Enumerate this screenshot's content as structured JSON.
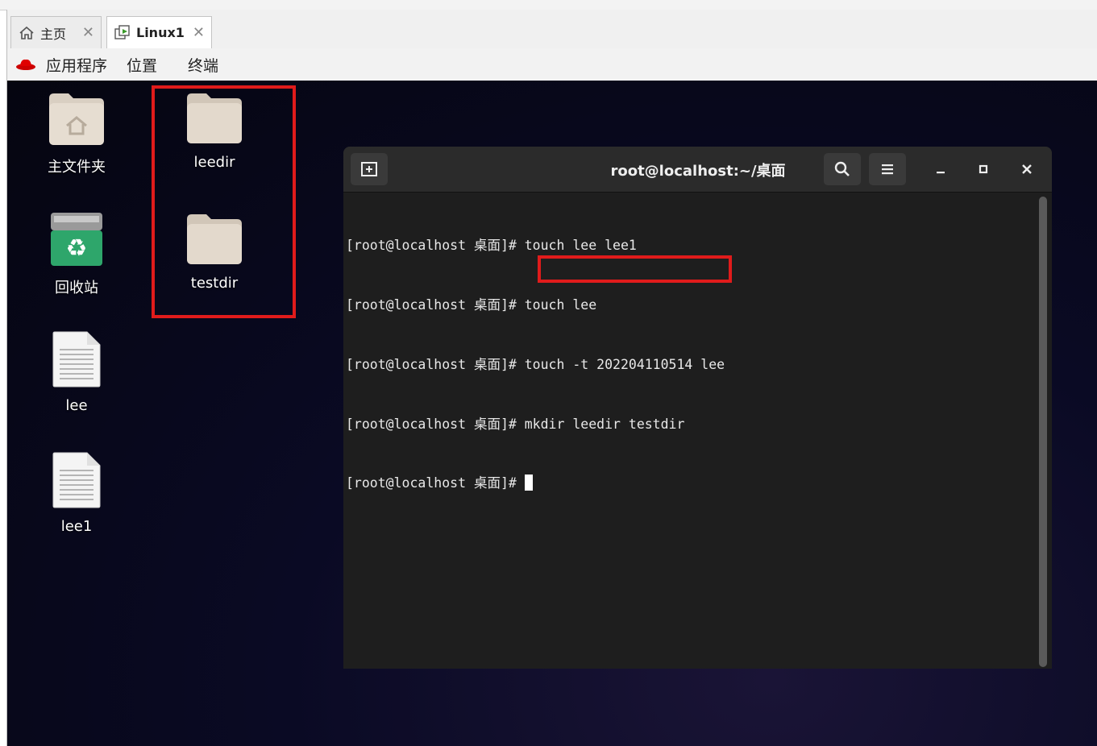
{
  "tabs": [
    {
      "label": "主页",
      "icon": "home-icon",
      "active": false
    },
    {
      "label": "Linux1",
      "icon": "vm-icon",
      "active": true
    }
  ],
  "menubar": {
    "items": [
      "应用程序",
      "位置",
      "终端"
    ]
  },
  "desktop": {
    "icons": [
      {
        "label": "主文件夹",
        "icon": "home-folder-icon"
      },
      {
        "label": "回收站",
        "icon": "trash-icon"
      },
      {
        "label": "lee",
        "icon": "text-file-icon"
      },
      {
        "label": "lee1",
        "icon": "text-file-icon"
      },
      {
        "label": "leedir",
        "icon": "folder-icon"
      },
      {
        "label": "testdir",
        "icon": "folder-icon"
      }
    ]
  },
  "terminal": {
    "title": "root@localhost:~/桌面",
    "lines": [
      "[root@localhost 桌面]# touch lee lee1",
      "[root@localhost 桌面]# touch lee",
      "[root@localhost 桌面]# touch -t 202204110514 lee",
      "[root@localhost 桌面]# mkdir leedir testdir",
      "[root@localhost 桌面]# "
    ]
  },
  "colors": {
    "highlight": "#e01b1b",
    "terminal_bg": "#1e1e1e",
    "titlebar_bg": "#2b2b2b"
  }
}
